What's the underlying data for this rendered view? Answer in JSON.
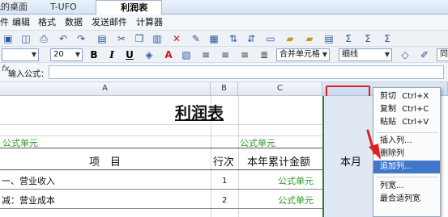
{
  "tabs": [
    {
      "label": "我的桌面",
      "active": false
    },
    {
      "label": "T-UFO",
      "active": false
    },
    {
      "label": "利润表",
      "active": true
    }
  ],
  "menu": [
    "件",
    "编辑",
    "格式",
    "数据",
    "发送邮件",
    "计算器"
  ],
  "toolbar2": {
    "font_size": "20",
    "merge_label": "合并单元格",
    "border_label": "细线",
    "tail_label": "同"
  },
  "formula": {
    "label": "输入公式："
  },
  "grid": {
    "col_headers": [
      "A",
      "B",
      "C"
    ],
    "title": "利润表",
    "formula_cell_a": "公式单元",
    "formula_cell_c": "公式单元",
    "header_item": "项　目",
    "header_row_no": "行次",
    "header_ytd": "本年累计金额",
    "header_month": "本月",
    "rows": [
      {
        "item": "一、营业收入",
        "no": "1",
        "value": "公式单元"
      },
      {
        "item": "减：营业成本",
        "no": "2",
        "value": "公式单元"
      }
    ]
  },
  "context_menu": {
    "cut": "剪切",
    "cut_key": "Ctrl+X",
    "copy": "复制",
    "copy_key": "Ctrl+C",
    "paste": "粘贴",
    "paste_key": "Ctrl+V",
    "insert_col": "插入列...",
    "delete_col": "删除列",
    "append_col": "追加列...",
    "col_width": "列宽...",
    "fit_width": "最合适列宽"
  },
  "colors": {
    "highlight": "#3f78c8",
    "formula_green": "#2b9a2b",
    "annotation_red": "#e02020"
  }
}
